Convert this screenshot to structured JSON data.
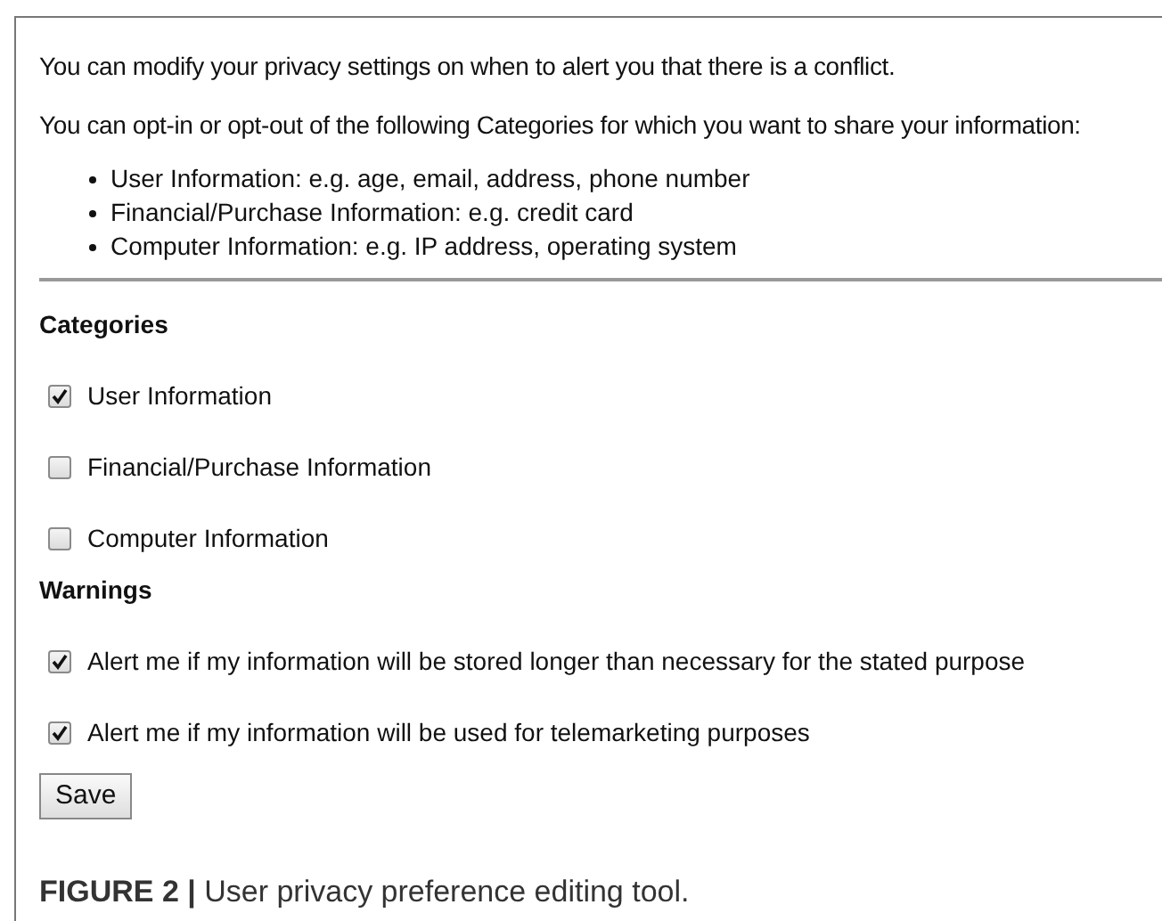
{
  "intro": [
    "You can modify your privacy settings on when to alert you that there is a conflict.",
    "You can opt-in or opt-out of the following Categories for which you want to share your information:"
  ],
  "bullets": [
    "User Information: e.g. age, email, address, phone number",
    "Financial/Purchase Information: e.g. credit card",
    "Computer Information: e.g. IP address, operating system"
  ],
  "categories": {
    "heading": "Categories",
    "items": [
      {
        "label": "User Information",
        "checked": true
      },
      {
        "label": "Financial/Purchase Information",
        "checked": false
      },
      {
        "label": "Computer Information",
        "checked": false
      }
    ]
  },
  "warnings": {
    "heading": "Warnings",
    "items": [
      {
        "label": "Alert me if my information will be stored longer than necessary for the stated purpose",
        "checked": true
      },
      {
        "label": "Alert me if my information will be used for telemarketing purposes",
        "checked": true
      }
    ]
  },
  "save_button": "Save",
  "caption": "**FIGURE 2 |** User privacy preference editing tool."
}
